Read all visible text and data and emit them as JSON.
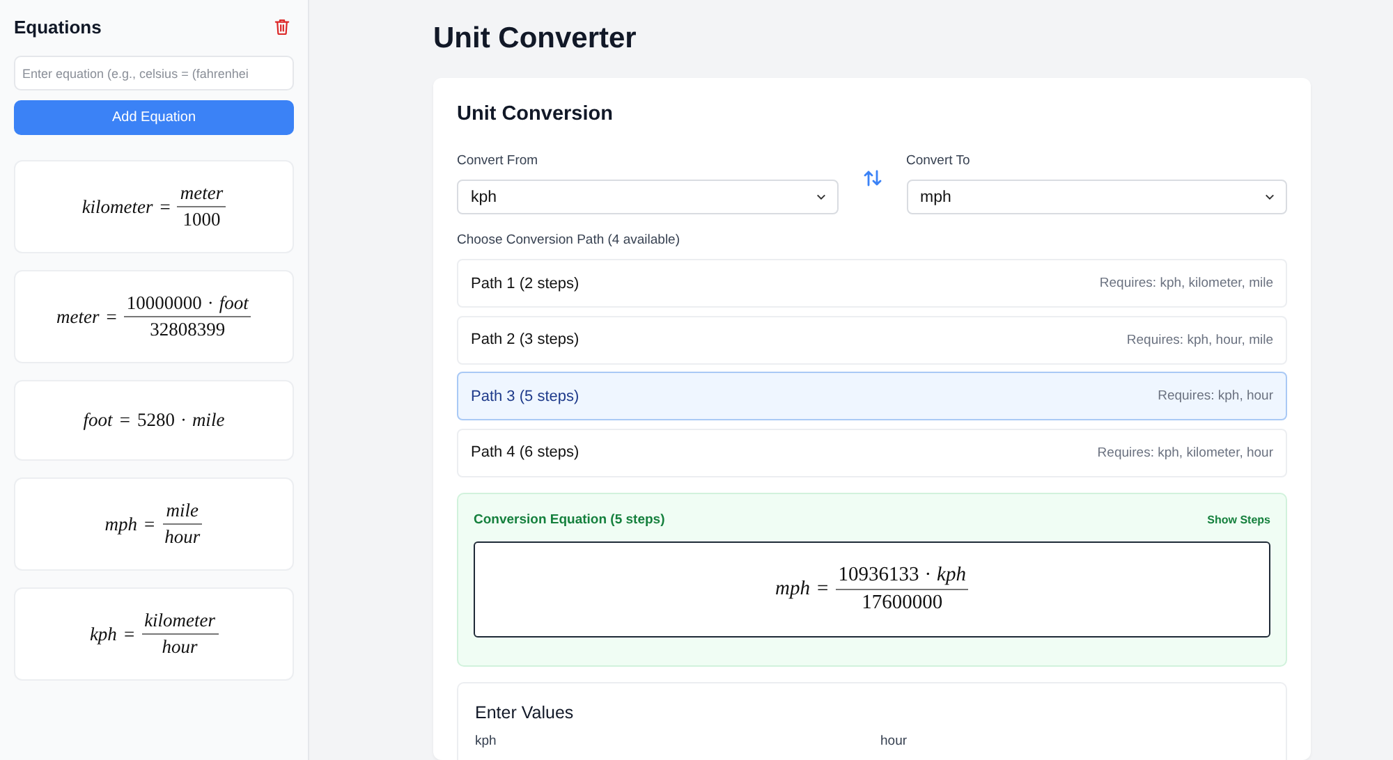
{
  "sidebar": {
    "title": "Equations",
    "equation_input": {
      "placeholder": "Enter equation (e.g., celsius = (fahrenhei"
    },
    "add_button": "Add Equation",
    "equations": [
      {
        "lhs": "kilometer",
        "relation": "=",
        "kind": "fraction",
        "numerator": [
          {
            "kind": "variable",
            "text": "meter"
          }
        ],
        "denominator": [
          {
            "kind": "number",
            "text": "1000"
          }
        ]
      },
      {
        "lhs": "meter",
        "relation": "=",
        "kind": "fraction",
        "numerator": [
          {
            "kind": "number",
            "text": "10000000"
          },
          {
            "kind": "operator",
            "text": "·"
          },
          {
            "kind": "variable",
            "text": "foot"
          }
        ],
        "denominator": [
          {
            "kind": "number",
            "text": "32808399"
          }
        ]
      },
      {
        "lhs": "foot",
        "relation": "=",
        "kind": "inline",
        "terms": [
          {
            "kind": "number",
            "text": "5280"
          },
          {
            "kind": "operator",
            "text": "·"
          },
          {
            "kind": "variable",
            "text": "mile"
          }
        ]
      },
      {
        "lhs": "mph",
        "relation": "=",
        "kind": "fraction",
        "numerator": [
          {
            "kind": "variable",
            "text": "mile"
          }
        ],
        "denominator": [
          {
            "kind": "variable",
            "text": "hour"
          }
        ]
      },
      {
        "lhs": "kph",
        "relation": "=",
        "kind": "fraction",
        "numerator": [
          {
            "kind": "variable",
            "text": "kilometer"
          }
        ],
        "denominator": [
          {
            "kind": "variable",
            "text": "hour"
          }
        ]
      }
    ]
  },
  "page_title": "Unit Converter",
  "conversion": {
    "title": "Unit Conversion",
    "from": {
      "label": "Convert From",
      "value": "kph"
    },
    "to": {
      "label": "Convert To",
      "value": "mph"
    },
    "paths_label": "Choose Conversion Path (4 available)",
    "paths": [
      {
        "label": "Path 1 (2 steps)",
        "requires": "Requires: kph, kilometer, mile",
        "selected": false
      },
      {
        "label": "Path 2 (3 steps)",
        "requires": "Requires: kph, hour, mile",
        "selected": false
      },
      {
        "label": "Path 3 (5 steps)",
        "requires": "Requires: kph, hour",
        "selected": true
      },
      {
        "label": "Path 4 (6 steps)",
        "requires": "Requires: kph, kilometer, hour",
        "selected": false
      }
    ],
    "result": {
      "title": "Conversion Equation (5 steps)",
      "toggle": "Show Steps",
      "equation": {
        "lhs": "mph",
        "relation": "=",
        "kind": "fraction",
        "numerator": [
          {
            "kind": "number",
            "text": "10936133"
          },
          {
            "kind": "operator",
            "text": "·"
          },
          {
            "kind": "variable",
            "text": "kph"
          }
        ],
        "denominator": [
          {
            "kind": "number",
            "text": "17600000"
          }
        ]
      }
    }
  },
  "values": {
    "title": "Enter Values",
    "fields": [
      {
        "label": "kph"
      },
      {
        "label": "hour"
      }
    ]
  }
}
